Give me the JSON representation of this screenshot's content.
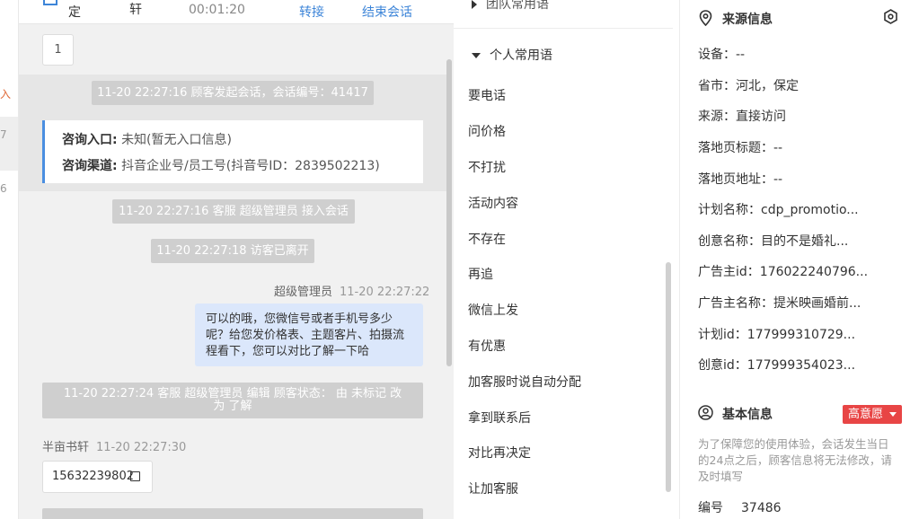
{
  "left_strip": {
    "chars": [
      "入",
      "7",
      "6"
    ]
  },
  "chat": {
    "header": {
      "name_partial": "定",
      "name_partial2": "轩",
      "timer": "00:01:20",
      "transfer_label": "转接",
      "end_label": "结束会话"
    },
    "count_box": "1",
    "system_start": "11-20 22:27:16 顾客发起会话，会话编号：41417",
    "entry_card": {
      "entry_label": "咨询入口:",
      "entry_value": "未知(暂无入口信息)",
      "channel_label": "咨询渠道:",
      "channel_value": "抖音企业号/员工号(抖音号ID：2839502213)"
    },
    "system_join": "11-20 22:27:16 客服 超级管理员 接入会话",
    "system_left": "11-20 22:27:18 访客已离开",
    "agent_msg": {
      "name": "超级管理员",
      "time": "11-20 22:27:22",
      "text": "可以的哦，您微信号或者手机号多少呢？给您发价格表、主题客片、拍摄流程看下，您可以对比了解一下哈"
    },
    "system_edit": "11-20 22:27:24 客服 超级管理员 编辑 顾客状态： 由 未标记 改为 了解",
    "visitor_msg": {
      "name": "半亩书轩",
      "time": "11-20 22:27:30",
      "text": "15632239802"
    }
  },
  "phrases": {
    "team_group": "团队常用语",
    "personal_group": "个人常用语",
    "items": [
      "要电话",
      "问价格",
      "不打扰",
      "活动内容",
      "不存在",
      "再追",
      "微信上发",
      "有优惠",
      "加客服时说自动分配",
      "拿到联系后",
      "对比再决定",
      "让加客服"
    ]
  },
  "info": {
    "source_title": "来源信息",
    "source_rows": [
      {
        "k": "设备：",
        "v": "--"
      },
      {
        "k": "省市：",
        "v": "河北，保定"
      },
      {
        "k": "来源：",
        "v": "直接访问"
      },
      {
        "k": "落地页标题：",
        "v": "--"
      },
      {
        "k": "落地页地址：",
        "v": "--"
      },
      {
        "k": "计划名称：",
        "v": "cdp_promotio..."
      },
      {
        "k": "创意名称：",
        "v": "目的不是婚礼..."
      },
      {
        "k": "广告主id：",
        "v": "176022240796..."
      },
      {
        "k": "广告主名称：",
        "v": "提米映画婚前..."
      },
      {
        "k": "计划id：",
        "v": "177999310729..."
      },
      {
        "k": "创意id：",
        "v": "177999354023..."
      }
    ],
    "basic_title": "基本信息",
    "intent_badge": "高意愿",
    "notice": "为了保障您的使用体验，会话发生当日的24点之后，顾客信息将无法修改，请及时填写",
    "id_label": "编号",
    "id_value": "37486"
  }
}
